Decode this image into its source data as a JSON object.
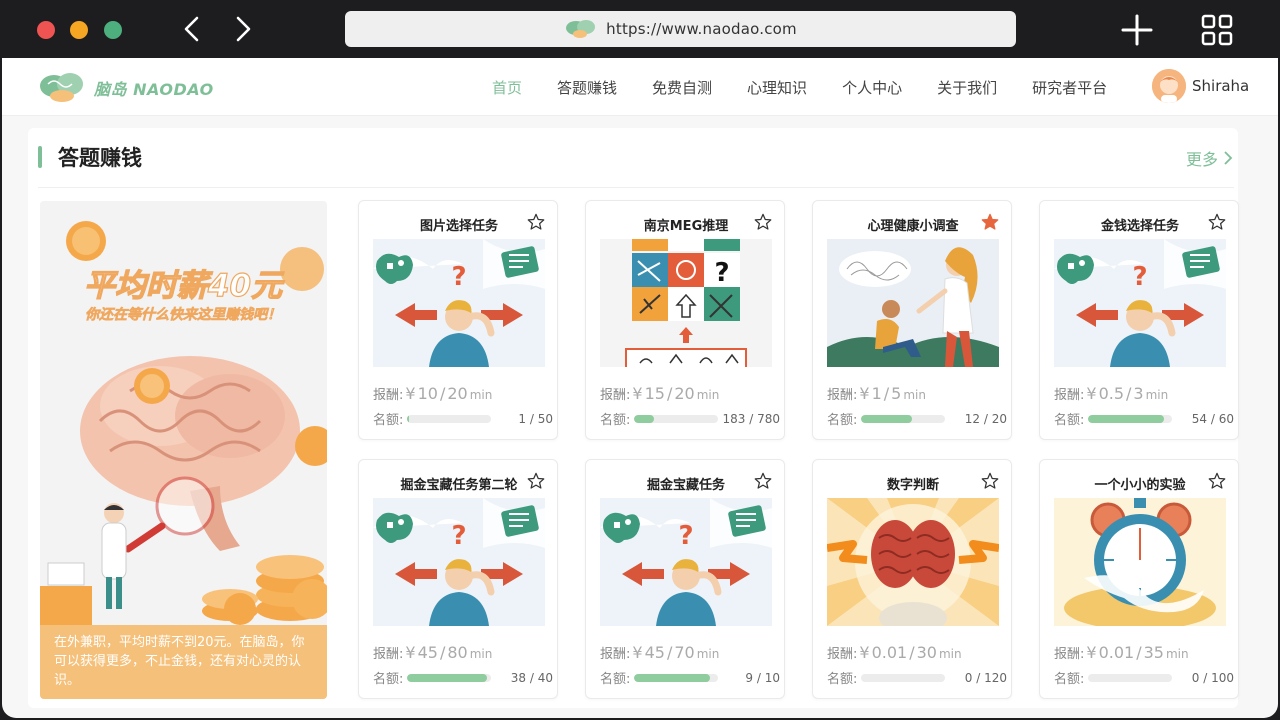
{
  "browser": {
    "url": "https://www.naodao.com",
    "icons": [
      "back-arrow-icon",
      "forward-arrow-icon",
      "plus-icon",
      "tabs-grid-icon"
    ]
  },
  "site": {
    "brand": "脑岛 NAODAO",
    "accent": "#7fbf98"
  },
  "nav": {
    "items": [
      "首页",
      "答题赚钱",
      "免费自测",
      "心理知识",
      "个人中心",
      "关于我们",
      "研究者平台"
    ],
    "active_index": 0
  },
  "user": {
    "name": "Shiraha"
  },
  "section": {
    "title": "答题赚钱",
    "more": "更多"
  },
  "banner": {
    "headline": "平均时薪40元",
    "subline": "你还在等什么快来这里赚钱吧！",
    "caption": "在外兼职，平均时薪不到20元。在脑岛，你可以获得更多，不止金钱，还有对心灵的认识。"
  },
  "labels": {
    "reward": "报酬:",
    "quota": "名额:",
    "currency": "¥",
    "unit": "min"
  },
  "tasks": [
    {
      "title": "图片选择任务",
      "starred": false,
      "reward": "10",
      "duration": "20",
      "filled": 1,
      "total": 50,
      "image": "puzzled-person"
    },
    {
      "title": "南京MEG推理",
      "starred": false,
      "reward": "15",
      "duration": "20",
      "filled": 183,
      "total": 780,
      "image": "pattern-grid"
    },
    {
      "title": "心理健康小调查",
      "starred": true,
      "reward": "1",
      "duration": "5",
      "filled": 12,
      "total": 20,
      "image": "counseling"
    },
    {
      "title": "金钱选择任务",
      "starred": false,
      "reward": "0.5",
      "duration": "3",
      "filled": 54,
      "total": 60,
      "image": "puzzled-person"
    },
    {
      "title": "掘金宝藏任务第二轮",
      "starred": false,
      "reward": "45",
      "duration": "80",
      "filled": 38,
      "total": 40,
      "image": "puzzled-person"
    },
    {
      "title": "掘金宝藏任务",
      "starred": false,
      "reward": "45",
      "duration": "70",
      "filled": 9,
      "total": 10,
      "image": "puzzled-person"
    },
    {
      "title": "数字判断",
      "starred": false,
      "reward": "0.01",
      "duration": "30",
      "filled": 0,
      "total": 120,
      "image": "brain"
    },
    {
      "title": "一个小小的实验",
      "starred": false,
      "reward": "0.01",
      "duration": "35",
      "filled": 0,
      "total": 100,
      "image": "stopwatch"
    }
  ]
}
